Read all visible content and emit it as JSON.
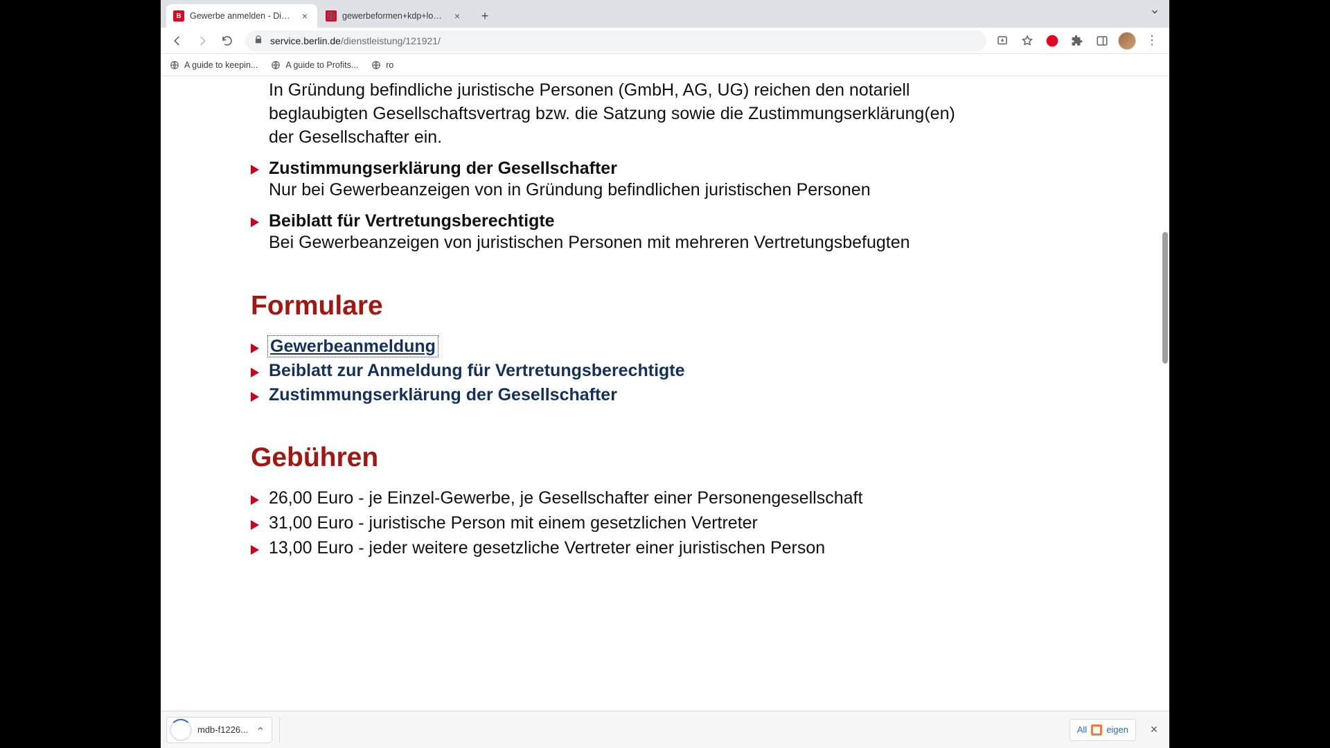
{
  "tabs": [
    {
      "title": "Gewerbe anmelden - Dienstle",
      "favicon": "B"
    },
    {
      "title": "gewerbeformen+kdp+low+con"
    }
  ],
  "toolbar": {
    "url_host": "service.berlin.de",
    "url_path": "/dienstleistung/121921/"
  },
  "bookmarks": [
    {
      "label": "A guide to keepin..."
    },
    {
      "label": "A guide to Profits..."
    },
    {
      "label": "ro"
    }
  ],
  "content": {
    "intro_para": "In Gründung befindliche juristische Personen (GmbH, AG, UG) reichen den notariell beglaubigten Gesellschaftsvertrag bzw. die Satzung sowie die Zustimmungserklärung(en) der Gesellschafter ein.",
    "req_items": [
      {
        "title": "Zustimmungserklärung der Gesellschafter",
        "body": "Nur bei Gewerbeanzeigen von in Gründung befindlichen juristischen Personen"
      },
      {
        "title": "Beiblatt für Vertretungsberechtigte",
        "body": "Bei Gewerbeanzeigen von juristischen Personen mit mehreren Vertretungsbefugten"
      }
    ],
    "forms_heading": "Formulare",
    "form_links": [
      "Gewerbeanmeldung",
      "Beiblatt zur Anmeldung für Vertretungsberechtigte",
      "Zustimmungserklärung der Gesellschafter"
    ],
    "fees_heading": "Gebühren",
    "fees": [
      "26,00 Euro - je Einzel-Gewerbe, je Gesellschafter einer Personengesellschaft",
      "31,00 Euro - juristische Person mit einem gesetzlichen Vertreter",
      "13,00 Euro - jeder weitere gesetzliche Vertreter einer juristischen Person"
    ]
  },
  "download": {
    "filename": "mdb-f1226...",
    "show_all_left": "All",
    "show_all_right": "eigen"
  }
}
